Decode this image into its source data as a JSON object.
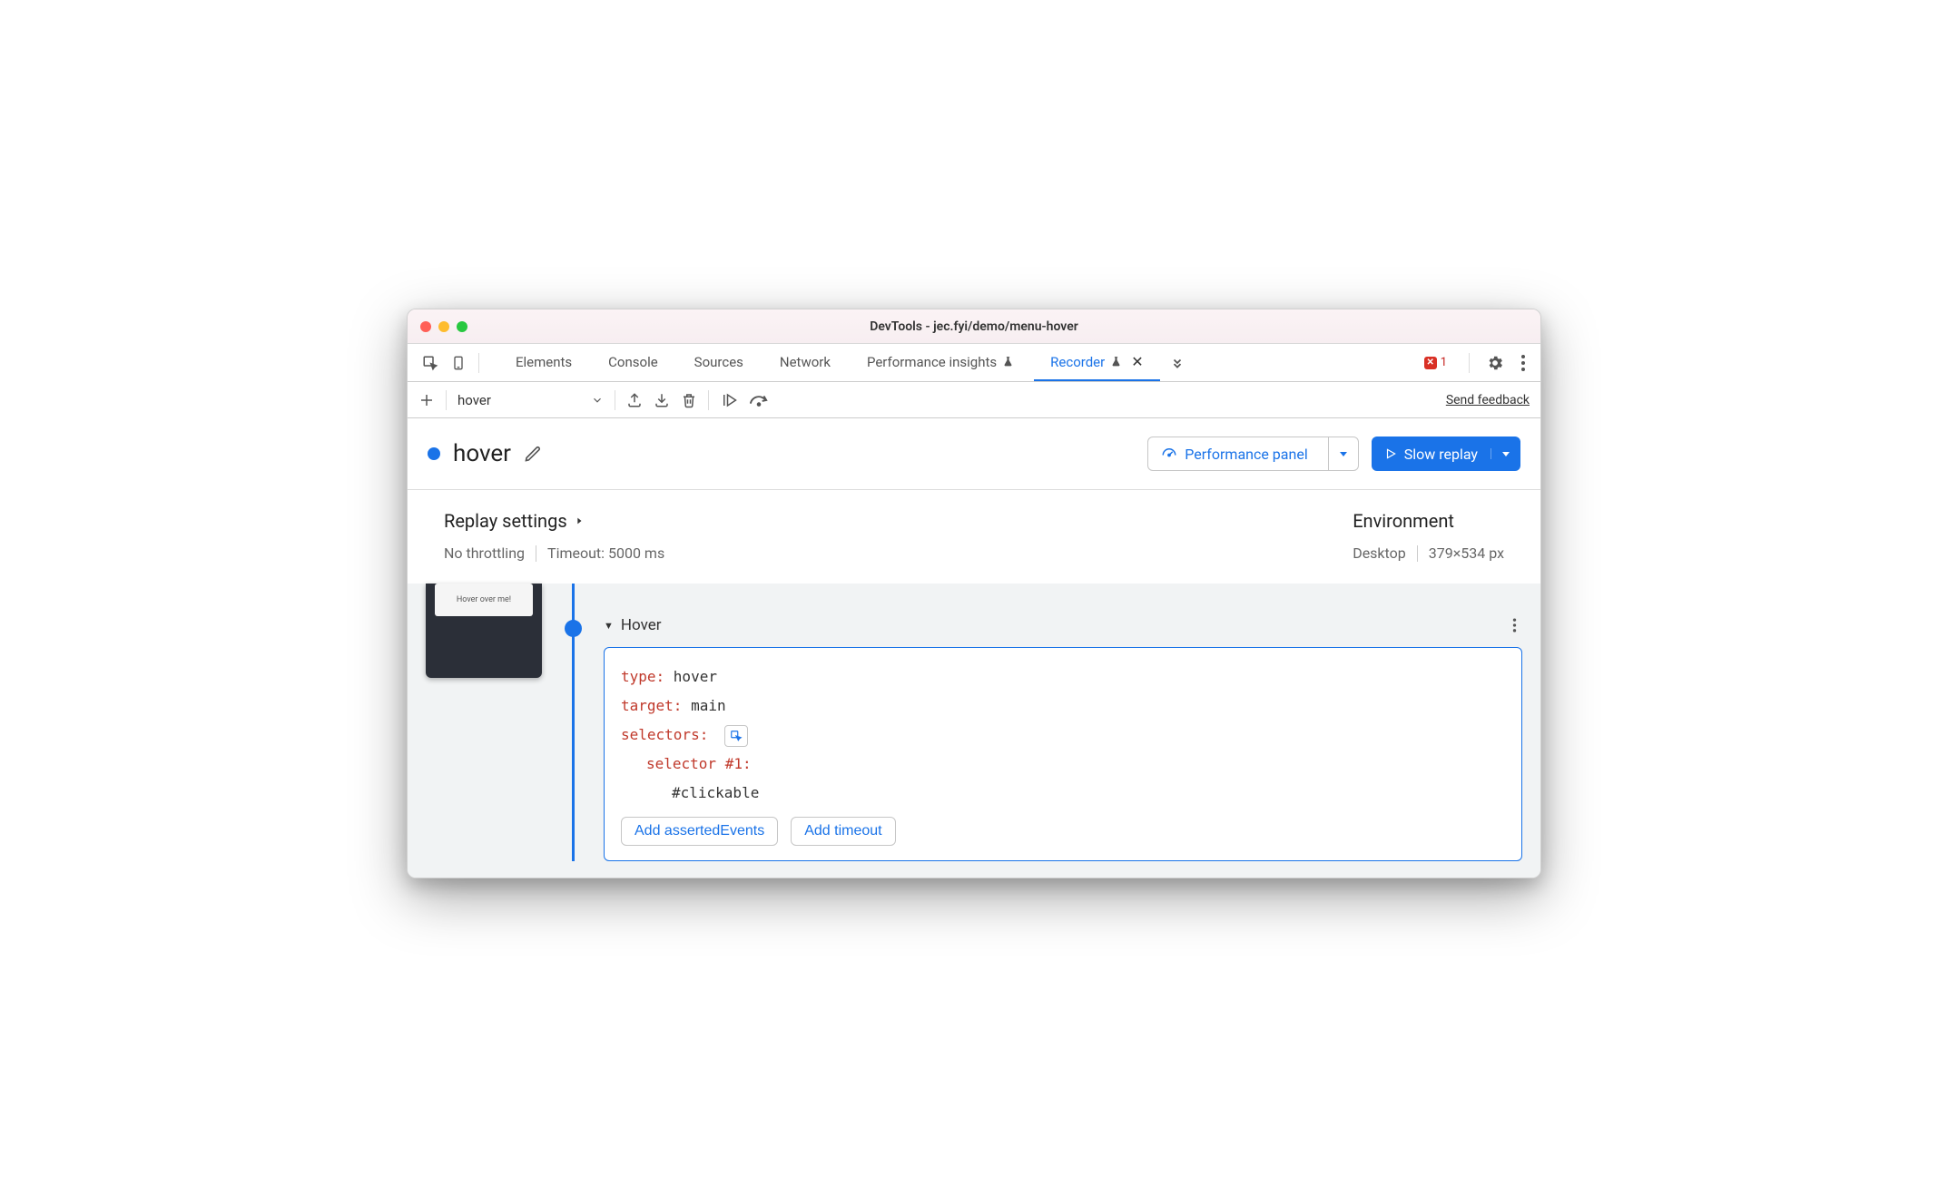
{
  "window": {
    "title": "DevTools - jec.fyi/demo/menu-hover"
  },
  "tabs": {
    "items": [
      {
        "label": "Elements",
        "beaker": false,
        "active": false,
        "closable": false
      },
      {
        "label": "Console",
        "beaker": false,
        "active": false,
        "closable": false
      },
      {
        "label": "Sources",
        "beaker": false,
        "active": false,
        "closable": false
      },
      {
        "label": "Network",
        "beaker": false,
        "active": false,
        "closable": false
      },
      {
        "label": "Performance insights",
        "beaker": true,
        "active": false,
        "closable": false
      },
      {
        "label": "Recorder",
        "beaker": true,
        "active": true,
        "closable": true
      }
    ],
    "errors": "1"
  },
  "toolbar": {
    "recording_name": "hover",
    "feedback": "Send feedback"
  },
  "header": {
    "title": "hover",
    "perf_button": "Performance panel",
    "replay_button": "Slow replay"
  },
  "settings": {
    "title": "Replay settings",
    "throttling": "No throttling",
    "timeout": "Timeout: 5000 ms",
    "env_title": "Environment",
    "env_device": "Desktop",
    "env_dims": "379×534 px"
  },
  "step": {
    "title": "Hover",
    "type_key": "type",
    "type_val": "hover",
    "target_key": "target",
    "target_val": "main",
    "selectors_key": "selectors",
    "selector_n_key": "selector #1",
    "selector_n_val": "#clickable",
    "add_asserted": "Add assertedEvents",
    "add_timeout": "Add timeout"
  },
  "thumb": {
    "label": "Hover over me!"
  }
}
